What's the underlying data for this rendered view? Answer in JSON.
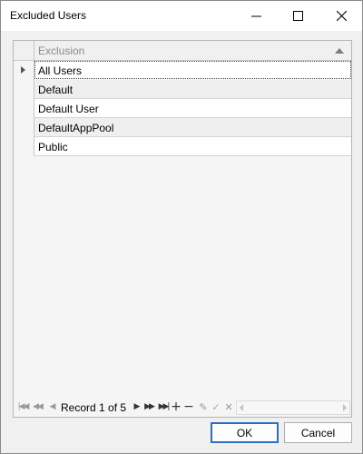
{
  "window": {
    "title": "Excluded Users"
  },
  "grid": {
    "column_header": "Exclusion",
    "sort": "ascending",
    "rows": [
      "All Users",
      "Default",
      "Default User",
      "DefaultAppPool",
      "Public"
    ],
    "selected_row": 0
  },
  "navigator": {
    "record_text": "Record 1 of 5"
  },
  "buttons": {
    "ok": "OK",
    "cancel": "Cancel"
  },
  "colors": {
    "ok_border": "#2b6fc4",
    "alt_row": "#efefef"
  }
}
